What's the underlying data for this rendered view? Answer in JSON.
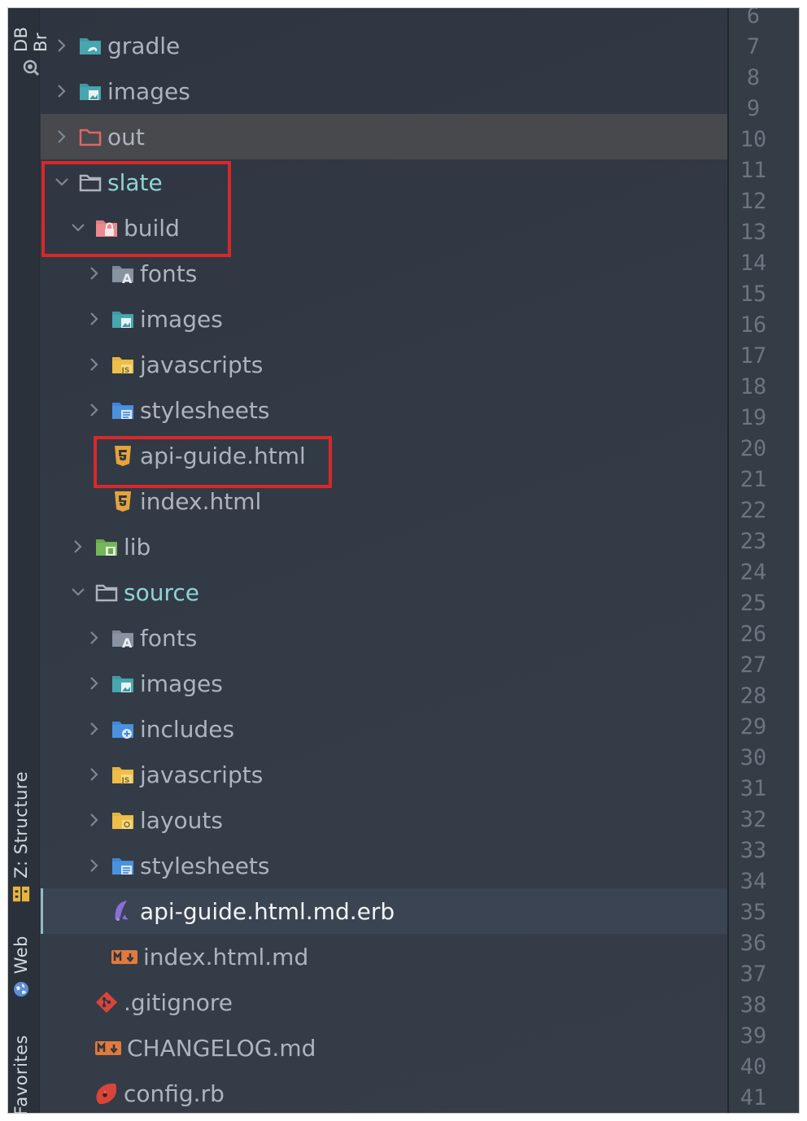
{
  "toolstrip": {
    "top_label": "DB Br",
    "structure_label": "Z: Structure",
    "web_label": "Web",
    "favorites_label": "Favorites"
  },
  "tree": [
    {
      "label": "gradle",
      "indent": 0,
      "chevron": "right",
      "icon": "folder-teal-gradle",
      "style": ""
    },
    {
      "label": "images",
      "indent": 0,
      "chevron": "right",
      "icon": "folder-teal-image",
      "style": ""
    },
    {
      "label": "out",
      "indent": 0,
      "chevron": "right",
      "icon": "folder-red-outline",
      "style": "sel-gray"
    },
    {
      "label": "slate",
      "indent": 0,
      "chevron": "down",
      "icon": "folder-outline",
      "style": "teal"
    },
    {
      "label": "build",
      "indent": 1,
      "chevron": "down",
      "icon": "folder-pink-lock",
      "style": ""
    },
    {
      "label": "fonts",
      "indent": 2,
      "chevron": "right",
      "icon": "folder-gray-font",
      "style": ""
    },
    {
      "label": "images",
      "indent": 2,
      "chevron": "right",
      "icon": "folder-teal-image",
      "style": ""
    },
    {
      "label": "javascripts",
      "indent": 2,
      "chevron": "right",
      "icon": "folder-yellow-js",
      "style": ""
    },
    {
      "label": "stylesheets",
      "indent": 2,
      "chevron": "right",
      "icon": "folder-blue-css",
      "style": ""
    },
    {
      "label": "api-guide.html",
      "indent": 2,
      "chevron": "none",
      "icon": "html5-file",
      "style": ""
    },
    {
      "label": "index.html",
      "indent": 2,
      "chevron": "none",
      "icon": "html5-file",
      "style": ""
    },
    {
      "label": "lib",
      "indent": 1,
      "chevron": "right",
      "icon": "folder-green-lib",
      "style": ""
    },
    {
      "label": "source",
      "indent": 1,
      "chevron": "down",
      "icon": "folder-outline",
      "style": "teal"
    },
    {
      "label": "fonts",
      "indent": 2,
      "chevron": "right",
      "icon": "folder-gray-font",
      "style": ""
    },
    {
      "label": "images",
      "indent": 2,
      "chevron": "right",
      "icon": "folder-teal-image",
      "style": ""
    },
    {
      "label": "includes",
      "indent": 2,
      "chevron": "right",
      "icon": "folder-blue-plus",
      "style": ""
    },
    {
      "label": "javascripts",
      "indent": 2,
      "chevron": "right",
      "icon": "folder-yellow-js",
      "style": ""
    },
    {
      "label": "layouts",
      "indent": 2,
      "chevron": "right",
      "icon": "folder-yellow-layout",
      "style": ""
    },
    {
      "label": "stylesheets",
      "indent": 2,
      "chevron": "right",
      "icon": "folder-blue-css",
      "style": ""
    },
    {
      "label": "api-guide.html.md.erb",
      "indent": 2,
      "chevron": "none",
      "icon": "erb-file",
      "style": "sel-blue"
    },
    {
      "label": "index.html.md",
      "indent": 2,
      "chevron": "none",
      "icon": "markdown-file",
      "style": ""
    },
    {
      "label": ".gitignore",
      "indent": 1,
      "chevron": "none",
      "icon": "git-file",
      "style": ""
    },
    {
      "label": "CHANGELOG.md",
      "indent": 1,
      "chevron": "none",
      "icon": "markdown-file",
      "style": ""
    },
    {
      "label": "config.rb",
      "indent": 1,
      "chevron": "none",
      "icon": "ruby-file",
      "style": ""
    }
  ],
  "line_numbers": [
    "6",
    "7",
    "8",
    "9",
    "10",
    "11",
    "12",
    "13",
    "14",
    "15",
    "16",
    "17",
    "18",
    "19",
    "20",
    "21",
    "22",
    "23",
    "24",
    "25",
    "26",
    "27",
    "28",
    "29",
    "30",
    "31",
    "32",
    "33",
    "34",
    "35",
    "36",
    "37",
    "38",
    "39",
    "40",
    "41"
  ],
  "colors": {
    "highlight": "#d8282a",
    "teal_label": "#8fd4d6",
    "default_label": "#aeb4bd",
    "selected_label": "#f2f4f7"
  }
}
